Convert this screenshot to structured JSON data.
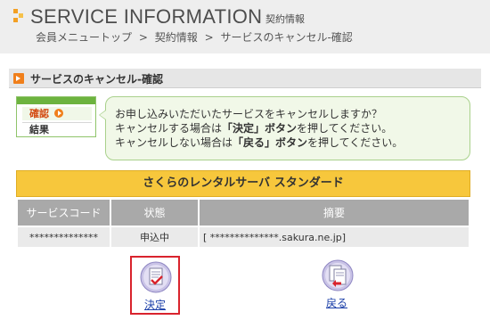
{
  "header": {
    "title": "SERVICE INFORMATION",
    "subtitle": "契約情報",
    "breadcrumb": [
      "会員メニュートップ",
      ">",
      "契約情報",
      ">",
      "サービスのキャンセル-確認"
    ]
  },
  "section": {
    "title": "サービスのキャンセル-確認"
  },
  "steps": {
    "current": "確認",
    "next": "結果"
  },
  "message": {
    "line1": "お申し込みいただいたサービスをキャンセルしますか？",
    "line2_prefix": "キャンセルする場合は",
    "line2_bold": "「決定」ボタン",
    "line2_suffix": "を押してください。",
    "line3_prefix": "キャンセルしない場合は",
    "line3_bold": "「戻る」ボタン",
    "line3_suffix": "を押してください。"
  },
  "service": {
    "title": "さくらのレンタルサーバ スタンダード",
    "headers": [
      "サービスコード",
      "状態",
      "摘要"
    ],
    "rows": [
      [
        "**************",
        "申込中",
        "[ **************.sakura.ne.jp]"
      ]
    ]
  },
  "actions": {
    "decide_label": "決定",
    "back_label": "戻る"
  },
  "colors": {
    "accent_orange": "#f07f1b",
    "service_header": "#f7c73c",
    "balloon_bg": "#f1f8e8",
    "highlight_border": "#d9232d",
    "link": "#1a3ea8"
  },
  "icons": {
    "header_mark": "orange-square-mark-icon",
    "section_bullet": "orange-arrow-bullet-icon",
    "step_arrow": "orange-circle-arrow-icon",
    "decide": "checked-document-icon",
    "back": "return-document-icon"
  }
}
